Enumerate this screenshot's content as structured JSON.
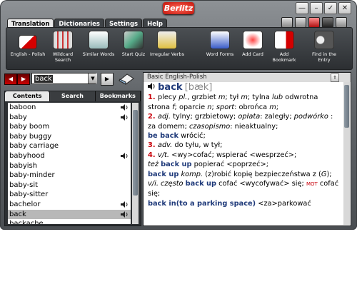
{
  "app": {
    "logo": "Berlitz"
  },
  "window_buttons": [
    "—",
    "–",
    "✓",
    "✕"
  ],
  "menu_tabs": [
    "Translation",
    "Dictionaries",
    "Settings",
    "Help"
  ],
  "toolbar": [
    {
      "label": "English - Polish",
      "icon": "flags-icon"
    },
    {
      "label": "Wildcard Search",
      "icon": "wildcard-icon"
    },
    {
      "label": "Similar Words",
      "icon": "similar-words-icon"
    },
    {
      "label": "Start Quiz",
      "icon": "quiz-icon"
    },
    {
      "label": "Irregular Verbs",
      "icon": "irregular-verbs-icon"
    },
    {
      "label": "Word Forms",
      "icon": "word-forms-icon"
    },
    {
      "label": "Add Card",
      "icon": "add-card-icon"
    },
    {
      "label": "Add Bookmark",
      "icon": "add-bookmark-icon"
    },
    {
      "label": "Find in the Entry",
      "icon": "binoculars-icon"
    }
  ],
  "search": {
    "value": "back"
  },
  "left_tabs": [
    "Contents",
    "Search",
    "Bookmarks"
  ],
  "word_list": [
    {
      "word": "baboon",
      "audio": true
    },
    {
      "word": "baby",
      "audio": true
    },
    {
      "word": "baby boom",
      "audio": false
    },
    {
      "word": "baby buggy",
      "audio": false
    },
    {
      "word": "baby carriage",
      "audio": false
    },
    {
      "word": "babyhood",
      "audio": true
    },
    {
      "word": "babyish",
      "audio": false
    },
    {
      "word": "baby-minder",
      "audio": false
    },
    {
      "word": "baby-sit",
      "audio": false
    },
    {
      "word": "baby-sitter",
      "audio": false
    },
    {
      "word": "bachelor",
      "audio": true
    },
    {
      "word": "back",
      "audio": true
    },
    {
      "word": "backache",
      "audio": false
    }
  ],
  "dictionary": {
    "title": "Basic English-Polish",
    "headword": "back",
    "phonetic": "[bæk]",
    "lines": [
      [
        [
          "num",
          "1. "
        ],
        [
          "t",
          "plecy "
        ],
        [
          "i",
          "pl."
        ],
        [
          "t",
          ", grzbiet "
        ],
        [
          "i",
          "m"
        ],
        [
          "t",
          "; tył "
        ],
        [
          "i",
          "m"
        ],
        [
          "t",
          "; tylna "
        ],
        [
          "i",
          "lub"
        ],
        [
          "t",
          " odwrotna strona "
        ],
        [
          "i",
          "f"
        ],
        [
          "t",
          "; oparcie "
        ],
        [
          "i",
          "n"
        ],
        [
          "t",
          "; "
        ],
        [
          "i",
          "sport"
        ],
        [
          "t",
          ": obrońca "
        ],
        [
          "i",
          "m"
        ],
        [
          "t",
          ";"
        ]
      ],
      [
        [
          "num",
          "2. "
        ],
        [
          "i",
          "adj."
        ],
        [
          "t",
          " tylny; grzbietowy; "
        ],
        [
          "i",
          "opłata"
        ],
        [
          "t",
          ": zaległy; "
        ],
        [
          "i",
          "podwórko"
        ],
        [
          "t",
          " : za domem; "
        ],
        [
          "i",
          "czasopismo"
        ],
        [
          "t",
          ": nieaktualny;"
        ]
      ],
      [
        [
          "phr",
          "be back"
        ],
        [
          "t",
          " wrócić;"
        ]
      ],
      [
        [
          "num",
          "3. "
        ],
        [
          "i",
          "adv."
        ],
        [
          "t",
          " do tyłu, w tył;"
        ]
      ],
      [
        [
          "num",
          "4. "
        ],
        [
          "i",
          "v/t."
        ],
        [
          "t",
          " <wy>cofać; wspierać <wesprzeć>;"
        ]
      ],
      [
        [
          "i",
          "też "
        ],
        [
          "phr",
          "back up"
        ],
        [
          "t",
          " popierać <poprzeć>;"
        ]
      ],
      [
        [
          "phr",
          "back up"
        ],
        [
          "t",
          " "
        ],
        [
          "i",
          "komp."
        ],
        [
          "t",
          " (z)robić kopię bezpieczeństwa z ("
        ],
        [
          "i",
          "G"
        ],
        [
          "t",
          ");"
        ]
      ],
      [
        [
          "i",
          "v/i. często "
        ],
        [
          "phr",
          "back up"
        ],
        [
          "t",
          " cofać <wycofywać> się; "
        ],
        [
          "mot",
          "MOT"
        ],
        [
          "t",
          " cofać się;"
        ]
      ],
      [
        [
          "phr",
          "back in(to a parking space)"
        ],
        [
          "t",
          " <za>parkować"
        ]
      ]
    ]
  }
}
